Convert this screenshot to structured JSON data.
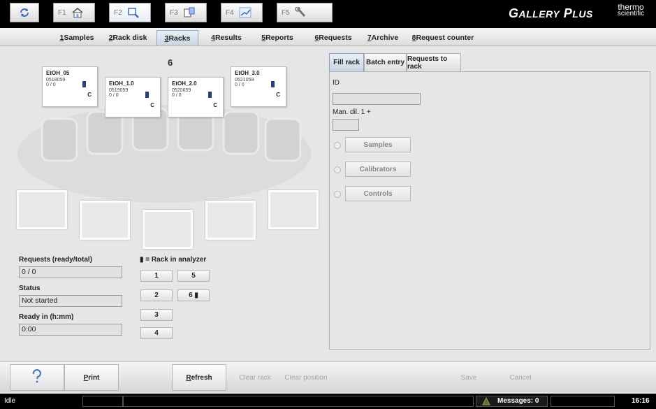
{
  "topbar": {
    "fkeys": [
      {
        "label": "",
        "icon": "refresh-icon"
      },
      {
        "label": "F1",
        "icon": "home-icon"
      },
      {
        "label": "F2",
        "icon": "search-icon"
      },
      {
        "label": "F3",
        "icon": "clipboard-icon"
      },
      {
        "label": "F4",
        "icon": "chart-icon"
      },
      {
        "label": "F5",
        "icon": "wrench-icon"
      }
    ],
    "brand": "Gallery Plus",
    "brand_a": "G",
    "brand_b": "ALLERY",
    "brand_c": "P",
    "brand_d": "LUS",
    "vendor_line1": "thermo",
    "vendor_line2": "scientific"
  },
  "tabs": [
    {
      "key": "1",
      "label": " Samples"
    },
    {
      "key": "2",
      "label": " Rack disk"
    },
    {
      "key": "3",
      "label": " Racks"
    },
    {
      "key": "4",
      "label": " Results"
    },
    {
      "key": "5",
      "label": " Reports"
    },
    {
      "key": "6",
      "label": " Requests"
    },
    {
      "key": "7",
      "label": " Archive"
    },
    {
      "key": "8",
      "label": " Request counter"
    }
  ],
  "rack": {
    "number": "6",
    "cards": [
      {
        "name": "EtOH_05",
        "id": "0518059",
        "value": "0 / 0",
        "code": "C"
      },
      {
        "name": "EtOH_1.0",
        "id": "0519059",
        "value": "0 / 0",
        "code": "C"
      },
      {
        "name": "EtOH_2.0",
        "id": "0520059",
        "value": "0 / 0",
        "code": "C"
      },
      {
        "name": "EtOH_3.0",
        "id": "0521059",
        "value": "0 / 0",
        "code": "C"
      }
    ]
  },
  "info": {
    "requests_label": "Requests (ready/total)",
    "requests_value": "0 / 0",
    "status_label": "Status",
    "status_value": "Not started",
    "ready_label": "Ready in (h:mm)",
    "ready_value": "0:00",
    "rack_legend": "= Rack in analyzer",
    "rack_buttons": [
      "1",
      "5",
      "2",
      "6",
      "3",
      "4"
    ]
  },
  "panel": {
    "tabs": [
      "Fill rack",
      "Batch entry",
      "Requests to rack"
    ],
    "id_label": "ID",
    "id_value": "",
    "dil_label": "Man. dil. 1 +",
    "dil_value": "",
    "options": [
      "Samples",
      "Calibrators",
      "Controls"
    ]
  },
  "toolbar": {
    "help_icon": "help-icon",
    "print_key": "P",
    "print_rest": "rint",
    "refresh_key": "R",
    "refresh_rest": "efresh",
    "clear_rack": "Clear rack",
    "clear_position": "Clear position",
    "save": "Save",
    "cancel": "Cancel"
  },
  "status": {
    "state": "Idle",
    "messages": "Messages: 0",
    "time": "16:16"
  }
}
